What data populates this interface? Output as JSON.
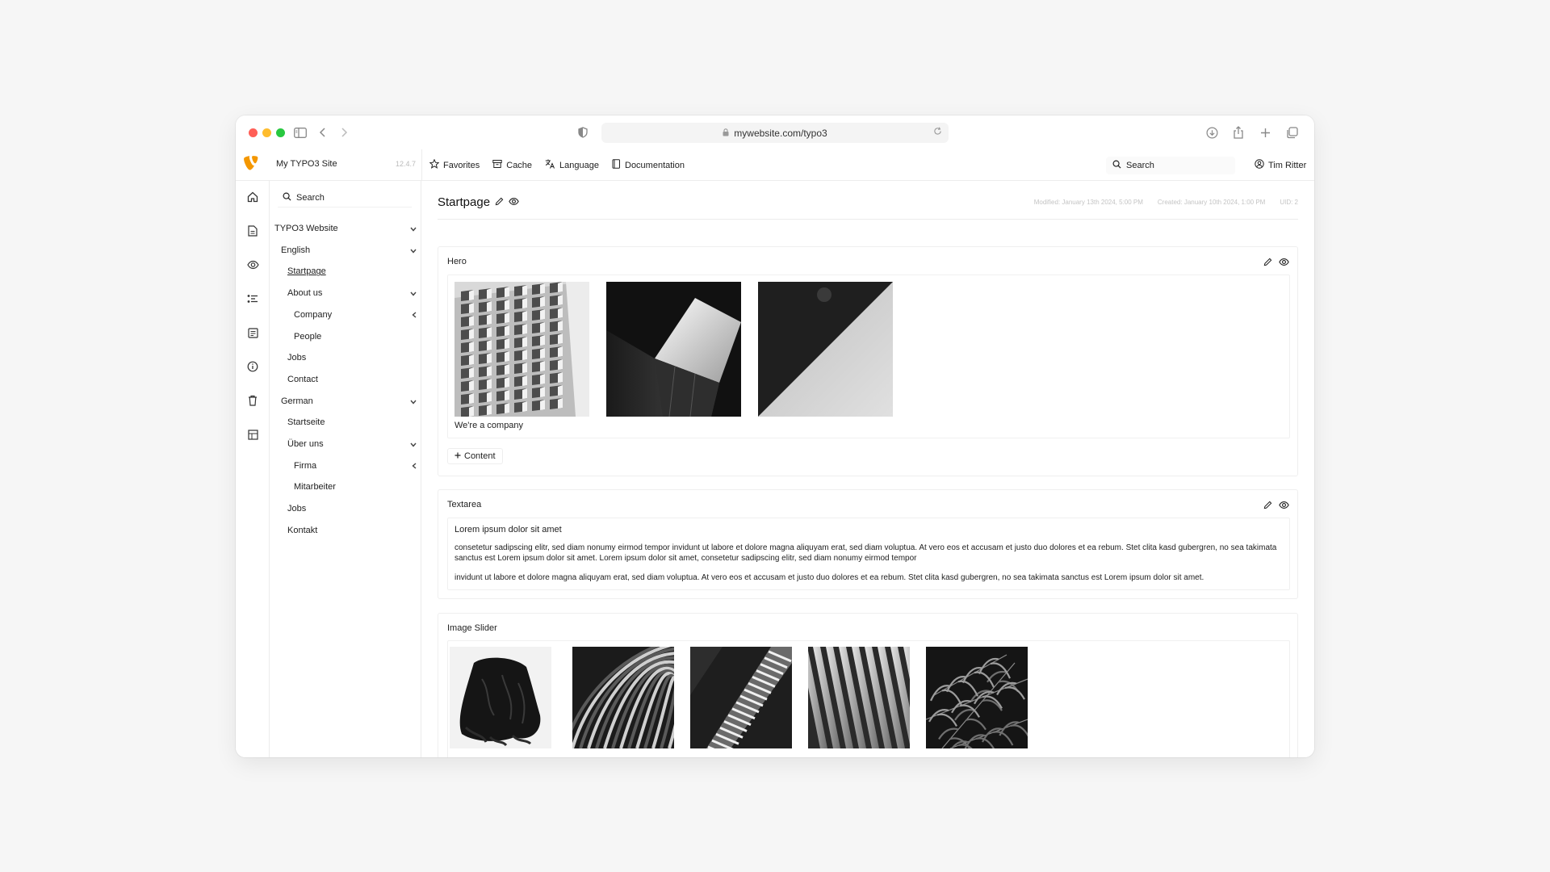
{
  "browser": {
    "url": "mywebsite.com/typo3"
  },
  "topbar": {
    "site_name": "My TYPO3 Site",
    "version": "12.4.7",
    "nav": [
      {
        "label": "Favorites",
        "icon": "star-icon"
      },
      {
        "label": "Cache",
        "icon": "archive-icon"
      },
      {
        "label": "Language",
        "icon": "translate-icon"
      },
      {
        "label": "Documentation",
        "icon": "book-icon"
      }
    ],
    "search_label": "Search",
    "user_name": "Tim Ritter"
  },
  "rail": {
    "icons": [
      "home-icon",
      "page-icon",
      "view-icon",
      "list-icon",
      "form-icon",
      "info-icon",
      "trash-icon",
      "table-icon"
    ]
  },
  "tree": {
    "search_label": "Search",
    "items": [
      {
        "label": "TYPO3 Website",
        "chevron": "down"
      },
      {
        "label": "English",
        "chevron": "down"
      },
      {
        "label": "Startpage",
        "chevron": "",
        "active": true
      },
      {
        "label": "About us",
        "chevron": "down"
      },
      {
        "label": "Company",
        "chevron": "left"
      },
      {
        "label": "People",
        "chevron": ""
      },
      {
        "label": "Jobs",
        "chevron": ""
      },
      {
        "label": "Contact",
        "chevron": ""
      },
      {
        "label": "German",
        "chevron": "down"
      },
      {
        "label": "Startseite",
        "chevron": ""
      },
      {
        "label": "Über uns",
        "chevron": "down"
      },
      {
        "label": "Firma",
        "chevron": "left"
      },
      {
        "label": "Mitarbeiter",
        "chevron": ""
      },
      {
        "label": "Jobs",
        "chevron": ""
      },
      {
        "label": "Kontakt",
        "chevron": ""
      }
    ]
  },
  "page": {
    "title": "Startpage",
    "modified": "Modified: January 13th 2024, 5:00 PM",
    "created": "Created: January 10th 2024, 1:00 PM",
    "uid": "UID: 2"
  },
  "hero": {
    "title": "Hero",
    "caption": "We're a company",
    "add_label": "Content"
  },
  "textarea": {
    "title": "Textarea",
    "heading": "Lorem ipsum dolor sit amet",
    "paragraph1": "consetetur sadipscing elitr, sed diam nonumy eirmod tempor invidunt ut labore et dolore magna aliquyam erat, sed diam voluptua. At vero eos et accusam et justo duo dolores et ea rebum. Stet clita kasd gubergren, no sea takimata sanctus est Lorem ipsum dolor sit amet. Lorem ipsum dolor sit amet, consetetur sadipscing elitr, sed diam nonumy eirmod tempor",
    "paragraph2": "invidunt ut labore et dolore magna aliquyam erat, sed diam voluptua. At vero eos et accusam et justo duo dolores et ea rebum. Stet clita kasd gubergren, no sea takimata sanctus est Lorem ipsum dolor sit amet."
  },
  "slider": {
    "title": "Image Slider"
  },
  "colors": {
    "brand": "#f49700",
    "traffic_red": "#ff5f57",
    "traffic_yellow": "#febc2e",
    "traffic_green": "#28c840"
  }
}
